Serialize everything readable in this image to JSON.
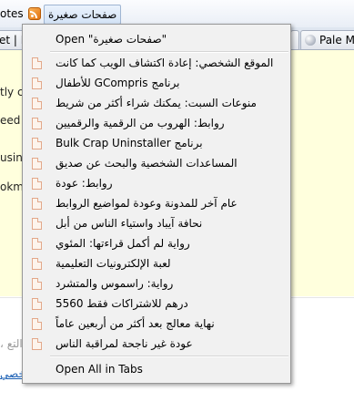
{
  "bookmarks_toolbar": {
    "left_fragment": "otes",
    "folder_label": "صفحات صغيرة"
  },
  "tabs": {
    "left_tab": "et | Lo",
    "right_tab": "Pale M"
  },
  "background": {
    "lines": [
      "tly cl",
      "eed",
      "usin",
      "okm"
    ],
    "gray_text": "، التع",
    "link_text": "خصي"
  },
  "menu": {
    "open_folder": "Open \"صفحات صغيرة\"",
    "items": [
      "الموقع الشخصي: إعادة اكتشاف الويب كما كانت",
      "برنامج GCompris للأطفال",
      "منوعات السبت: يمكنك شراء أكثر من شريط",
      "روابط: الهروب من الرقمية والرقميين",
      "برنامج Bulk Crap Uninstaller",
      "المساعدات الشخصية والبحث عن صديق",
      "روابط: عودة",
      "عام آخر للمدونة وعودة لمواضيع الروابط",
      "نحافة آيباد واستياء الناس من أبل",
      "رواية لم أكمل قراءتها: المئوي",
      "لعبة الإلكترونيات التعليمية",
      "رواية: راسموس والمتشرد",
      "درهم للاشتراكات فقط 5560",
      "نهاية معالج بعد أكثر من أربعين عاماً",
      "عودة غير ناجحة لمراقبة الناس"
    ],
    "open_all": "Open All in Tabs"
  },
  "colors": {
    "menu_bg": "#f1f1f1",
    "content_bg": "#ffffdd",
    "icon_border": "#e2a88a"
  }
}
